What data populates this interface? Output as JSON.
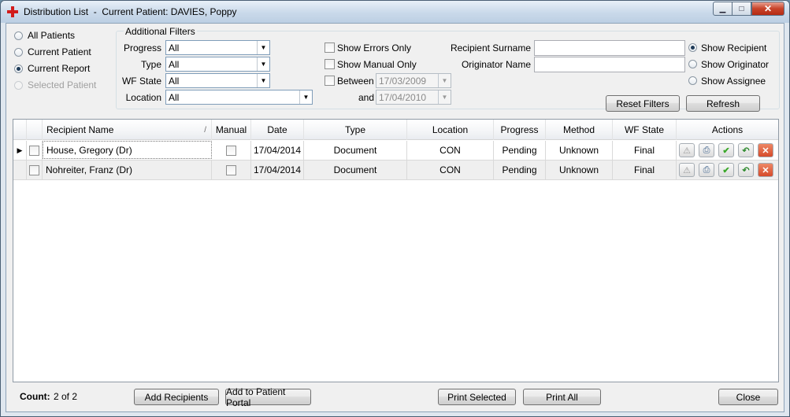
{
  "window": {
    "title": "Distribution List  -  Current Patient: DAVIES, Poppy",
    "minimize_glyph": "▁",
    "maximize_glyph": "□",
    "close_glyph": "✕"
  },
  "patient_scope": {
    "all_patients": "All Patients",
    "current_patient": "Current Patient",
    "current_report": "Current Report",
    "selected_patient": "Selected Patient",
    "selected": "current_report"
  },
  "filters": {
    "group_title": "Additional Filters",
    "progress_label": "Progress",
    "progress_value": "All",
    "type_label": "Type",
    "type_value": "All",
    "wf_state_label": "WF State",
    "wf_state_value": "All",
    "location_label": "Location",
    "location_value": "All",
    "show_errors_only": "Show Errors Only",
    "show_manual_only": "Show Manual Only",
    "between_label": "Between",
    "between_from": "17/03/2009",
    "and_label": "and",
    "between_to": "17/04/2010",
    "recipient_surname_label": "Recipient Surname",
    "recipient_surname_value": "",
    "originator_name_label": "Originator Name",
    "originator_name_value": "",
    "show_recipient": "Show Recipient",
    "show_originator": "Show Originator",
    "show_assignee": "Show Assignee",
    "show_selected": "recipient",
    "reset_filters": "Reset Filters",
    "refresh": "Refresh"
  },
  "grid": {
    "columns": [
      "Recipient Name",
      "Manual",
      "Date",
      "Type",
      "Location",
      "Progress",
      "Method",
      "WF State",
      "Actions"
    ],
    "sort_glyph": "/",
    "rows": [
      {
        "recipient": "House, Gregory (Dr)",
        "manual": false,
        "date": "17/04/2014",
        "type": "Document",
        "location": "CON",
        "progress": "Pending",
        "method": "Unknown",
        "wf_state": "Final",
        "current": true
      },
      {
        "recipient": "Nohreiter, Franz (Dr)",
        "manual": false,
        "date": "17/04/2014",
        "type": "Document",
        "location": "CON",
        "progress": "Pending",
        "method": "Unknown",
        "wf_state": "Final",
        "current": false
      }
    ],
    "action_icons": [
      "warning-icon",
      "print-icon",
      "check-icon",
      "undo-icon",
      "delete-icon"
    ]
  },
  "footer": {
    "count_label": "Count:",
    "count_value": "2  of  2",
    "add_recipients": "Add Recipients",
    "add_to_portal": "Add to Patient Portal",
    "print_selected": "Print Selected",
    "print_all": "Print All",
    "close": "Close"
  },
  "colors": {
    "title_accent": "#d21b1b",
    "check_green": "#3aa82a",
    "delete_red": "#d64a2a",
    "undo_green": "#2e8b2e"
  }
}
